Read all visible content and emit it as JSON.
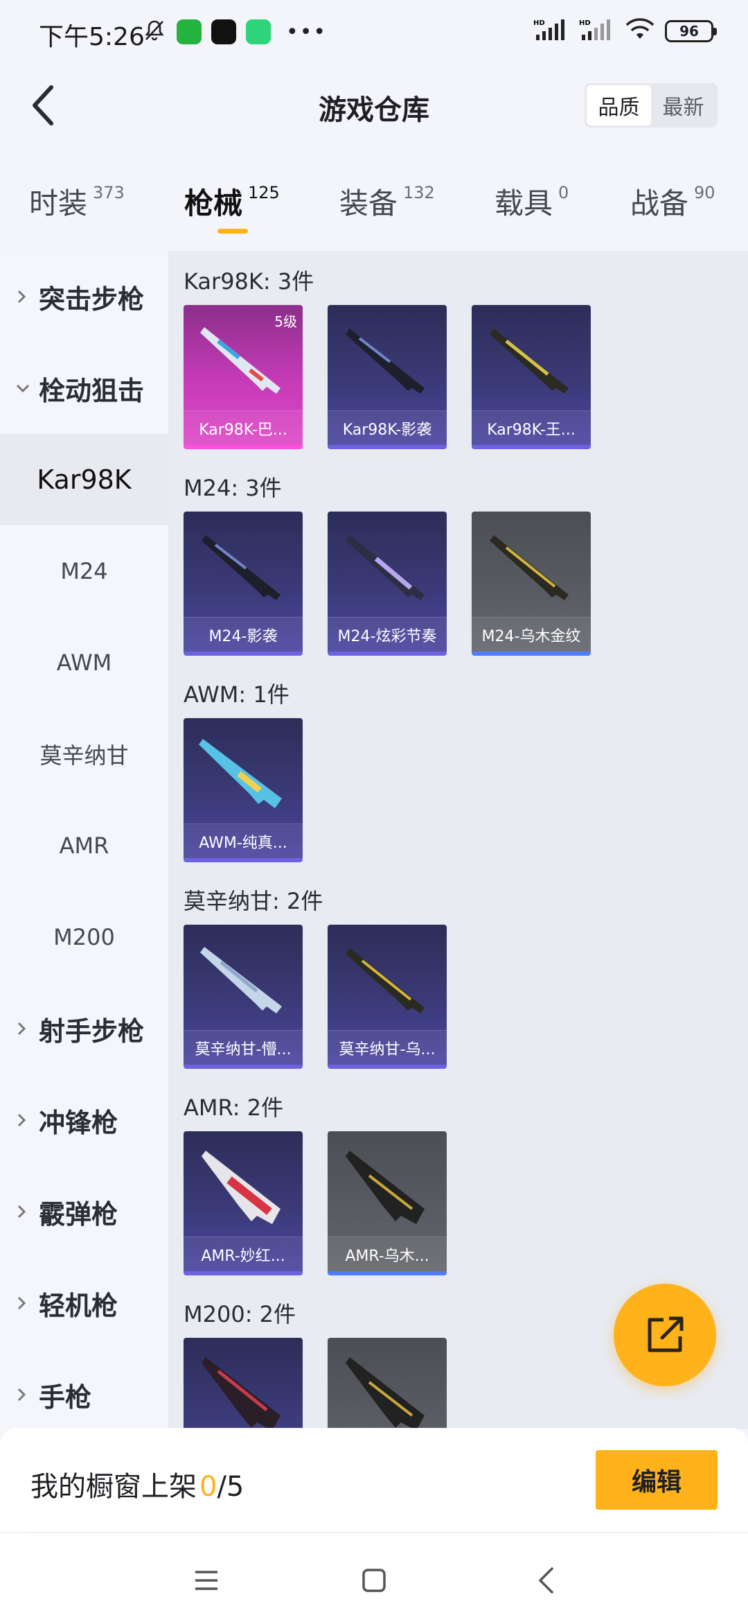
{
  "status_bar": {
    "time": "下午5:26",
    "battery": "96",
    "icons": [
      "mute-bell-icon",
      "iqiyi-app-icon",
      "tiktok-app-icon",
      "green-app-icon",
      "more-dots-icon",
      "hd-signal-icon",
      "hd-signal-icon",
      "wifi-icon",
      "battery-icon"
    ]
  },
  "header": {
    "title": "游戏仓库",
    "sort_options": [
      "品质",
      "最新"
    ],
    "sort_selected": "品质"
  },
  "tabs": [
    {
      "label": "时装",
      "count": "373"
    },
    {
      "label": "枪械",
      "count": "125",
      "active": true
    },
    {
      "label": "装备",
      "count": "132"
    },
    {
      "label": "载具",
      "count": "0"
    },
    {
      "label": "战备",
      "count": "90"
    }
  ],
  "sidebar": {
    "items": [
      {
        "label": "突击步枪",
        "type": "category",
        "expanded": false
      },
      {
        "label": "栓动狙击",
        "type": "category",
        "expanded": true
      },
      {
        "label": "Kar98K",
        "type": "weapon",
        "selected": true
      },
      {
        "label": "M24",
        "type": "weapon"
      },
      {
        "label": "AWM",
        "type": "weapon"
      },
      {
        "label": "莫辛纳甘",
        "type": "weapon"
      },
      {
        "label": "AMR",
        "type": "weapon"
      },
      {
        "label": "M200",
        "type": "weapon"
      },
      {
        "label": "射手步枪",
        "type": "category",
        "expanded": false
      },
      {
        "label": "冲锋枪",
        "type": "category",
        "expanded": false
      },
      {
        "label": "霰弹枪",
        "type": "category",
        "expanded": false
      },
      {
        "label": "轻机枪",
        "type": "category",
        "expanded": false
      },
      {
        "label": "手枪",
        "type": "category",
        "expanded": false
      }
    ]
  },
  "sections": [
    {
      "title": "Kar98K: 3件",
      "items": [
        {
          "name": "Kar98K-巴...",
          "rarity": "pink",
          "level": "5级"
        },
        {
          "name": "Kar98K-影袭",
          "rarity": "purple"
        },
        {
          "name": "Kar98K-王...",
          "rarity": "purple"
        }
      ]
    },
    {
      "title": "M24: 3件",
      "items": [
        {
          "name": "M24-影袭",
          "rarity": "purple"
        },
        {
          "name": "M24-炫彩节奏",
          "rarity": "purple"
        },
        {
          "name": "M24-乌木金纹",
          "rarity": "gray"
        }
      ]
    },
    {
      "title": "AWM: 1件",
      "items": [
        {
          "name": "AWM-纯真...",
          "rarity": "purple"
        }
      ]
    },
    {
      "title": "莫辛纳甘: 2件",
      "items": [
        {
          "name": "莫辛纳甘-懵...",
          "rarity": "purple"
        },
        {
          "name": "莫辛纳甘-乌...",
          "rarity": "purple"
        }
      ]
    },
    {
      "title": "AMR: 2件",
      "items": [
        {
          "name": "AMR-妙红...",
          "rarity": "purple"
        },
        {
          "name": "AMR-乌木...",
          "rarity": "gray"
        }
      ]
    },
    {
      "title": "M200: 2件",
      "items": [
        {
          "name": "",
          "rarity": "purple"
        },
        {
          "name": "",
          "rarity": "gray"
        }
      ]
    }
  ],
  "bottom": {
    "showcase_label": "我的橱窗上架",
    "showcase_current": "0",
    "showcase_total": "/5",
    "edit_label": "编辑"
  },
  "colors": {
    "accent": "#ffb21a",
    "purple_rarity": "#6d63e2",
    "pink_rarity": "#ff4fe0",
    "gray_rarity_bar": "#4f7cff"
  },
  "fab_icon": "share-export-icon",
  "nav": [
    "menu-icon",
    "home-square-icon",
    "back-arrow-icon"
  ]
}
